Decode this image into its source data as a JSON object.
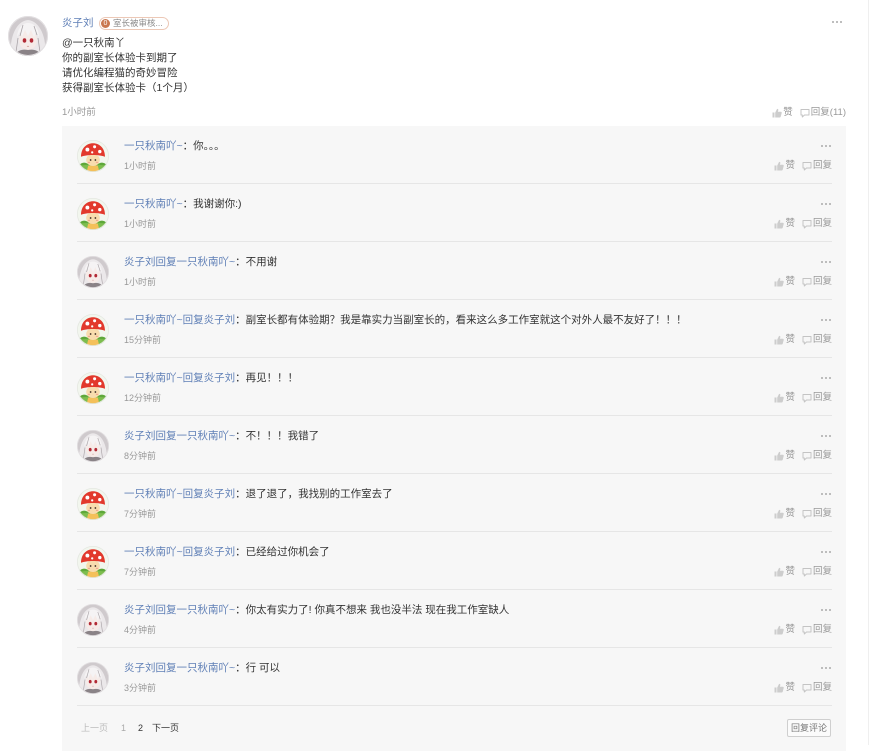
{
  "theme": {
    "link_color": "#5f7fb6",
    "panel_bg": "#f7f7f7",
    "badge_color": "#c9774f"
  },
  "post": {
    "avatar": "anime-girl-avatar",
    "author": "炎子刘",
    "badge_level": "0",
    "badge_text": "室长被审核...",
    "lines": [
      "@一只秋南丫",
      "你的副室长体验卡到期了",
      "请优化编程猫的奇妙冒险",
      "获得副室长体验卡（1个月）"
    ],
    "time": "1小时前",
    "like_label": "赞",
    "reply_label": "回复(11)",
    "more_icon": "more-dots-icon"
  },
  "ui": {
    "colon": "：",
    "like": "赞",
    "reply": "回复",
    "like_icon": "thumbs-up-icon",
    "reply_icon": "comment-icon"
  },
  "replies": [
    {
      "avatar": "mushroom-avatar",
      "author": "一只秋南吖~",
      "content": "你。。。",
      "time": "1小时前"
    },
    {
      "avatar": "mushroom-avatar",
      "author": "一只秋南吖~",
      "content": "我谢谢你:)",
      "time": "1小时前"
    },
    {
      "avatar": "anime-girl-avatar",
      "author": "炎子刘",
      "reply_word": "回复",
      "target": "一只秋南吖~",
      "content": "不用谢",
      "time": "1小时前"
    },
    {
      "avatar": "mushroom-avatar",
      "author": "一只秋南吖~",
      "reply_word": "回复",
      "target": "炎子刘",
      "content": "副室长都有体验期？我是靠实力当副室长的，看来这么多工作室就这个对外人最不友好了！！！",
      "time": "15分钟前"
    },
    {
      "avatar": "mushroom-avatar",
      "author": "一只秋南吖~",
      "reply_word": "回复",
      "target": "炎子刘",
      "content": "再见！！！",
      "time": "12分钟前"
    },
    {
      "avatar": "anime-girl-avatar",
      "author": "炎子刘",
      "reply_word": "回复",
      "target": "一只秋南吖~",
      "content": "不！！！我错了",
      "time": "8分钟前"
    },
    {
      "avatar": "mushroom-avatar",
      "author": "一只秋南吖~",
      "reply_word": "回复",
      "target": "炎子刘",
      "content": "退了退了，我找别的工作室去了",
      "time": "7分钟前"
    },
    {
      "avatar": "mushroom-avatar",
      "author": "一只秋南吖~",
      "reply_word": "回复",
      "target": "炎子刘",
      "content": "已经给过你机会了",
      "time": "7分钟前"
    },
    {
      "avatar": "anime-girl-avatar",
      "author": "炎子刘",
      "reply_word": "回复",
      "target": "一只秋南吖~",
      "content": "你太有实力了! 你真不想来 我也没半法 现在我工作室缺人",
      "time": "4分钟前"
    },
    {
      "avatar": "anime-girl-avatar",
      "author": "炎子刘",
      "reply_word": "回复",
      "target": "一只秋南吖~",
      "content": "行 可以",
      "time": "3分钟前"
    }
  ],
  "pagination": {
    "prev": "上一页",
    "pages": [
      "1",
      "2"
    ],
    "next": "下一页"
  },
  "comment_button": "回复评论"
}
